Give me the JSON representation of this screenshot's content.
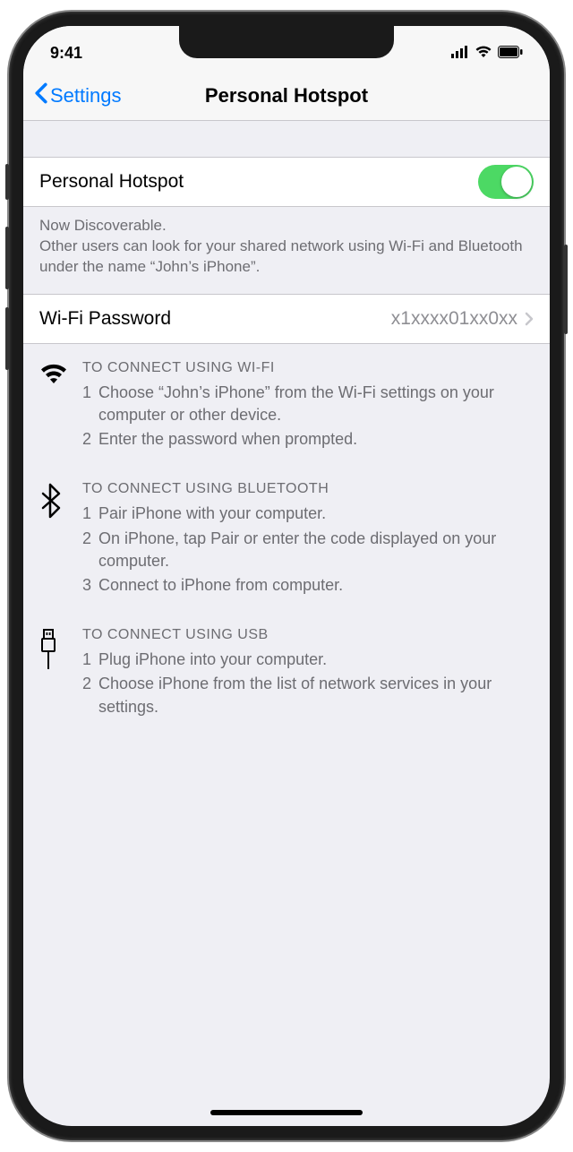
{
  "status": {
    "time": "9:41"
  },
  "nav": {
    "back": "Settings",
    "title": "Personal Hotspot"
  },
  "hotspot": {
    "label": "Personal Hotspot",
    "enabled": true,
    "footer_line1": "Now Discoverable.",
    "footer_line2": "Other users can look for your shared network using Wi-Fi and Bluetooth under the name “John’s iPhone”."
  },
  "password": {
    "label": "Wi-Fi Password",
    "value": "x1xxxx01xx0xx"
  },
  "instructions": {
    "wifi": {
      "title": "TO CONNECT USING WI-FI",
      "steps": [
        "Choose “John’s iPhone” from the Wi-Fi settings on your computer or other device.",
        "Enter the password when prompted."
      ]
    },
    "bluetooth": {
      "title": "TO CONNECT USING BLUETOOTH",
      "steps": [
        "Pair iPhone with your computer.",
        "On iPhone, tap Pair or enter the code displayed on your computer.",
        "Connect to iPhone from computer."
      ]
    },
    "usb": {
      "title": "TO CONNECT USING USB",
      "steps": [
        "Plug iPhone into your computer.",
        "Choose iPhone from the list of network services in your settings."
      ]
    }
  }
}
